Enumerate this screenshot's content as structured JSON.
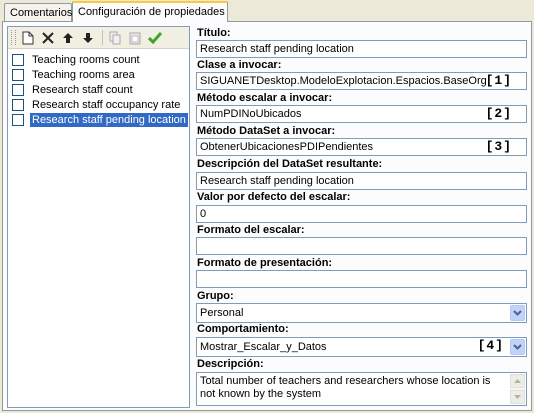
{
  "tabs": [
    {
      "label": "Comentarios"
    },
    {
      "label": "Configuración de propiedades"
    }
  ],
  "toolbar": {
    "icons": [
      "new-icon",
      "delete-icon",
      "move-up-icon",
      "move-down-icon",
      "copy-icon",
      "paste-icon",
      "apply-check-icon"
    ]
  },
  "list": {
    "items": [
      {
        "label": "Teaching rooms count",
        "checked": false,
        "selected": false
      },
      {
        "label": "Teaching rooms area",
        "checked": false,
        "selected": false
      },
      {
        "label": "Research staff count",
        "checked": false,
        "selected": false
      },
      {
        "label": "Research staff occupancy rate",
        "checked": false,
        "selected": false
      },
      {
        "label": "Research staff pending location",
        "checked": false,
        "selected": true
      }
    ]
  },
  "form": {
    "titulo": {
      "label": "Título:",
      "value": "Research staff pending location"
    },
    "clase": {
      "label": "Clase a invocar:",
      "value": "SIGUANETDesktop.ModeloExplotacion.Espacios.BaseOrg",
      "marker": "[1]"
    },
    "metodo_escalar": {
      "label": "Método escalar a invocar:",
      "value": "NumPDINoUbicados",
      "marker": "[2]"
    },
    "metodo_dataset": {
      "label": "Método DataSet a invocar:",
      "value": "ObtenerUbicacionesPDIPendientes",
      "marker": "[3]"
    },
    "descripcion_dataset": {
      "label": "Descripción del DataSet resultante:",
      "value": "Research staff pending location"
    },
    "valor_defecto": {
      "label": "Valor por defecto del escalar:",
      "value": "0"
    },
    "formato_escalar": {
      "label": "Formato del escalar:",
      "value": ""
    },
    "formato_presentacion": {
      "label": "Formato de presentación:",
      "value": ""
    },
    "grupo": {
      "label": "Grupo:",
      "value": "Personal"
    },
    "comportamiento": {
      "label": "Comportamiento:",
      "value": "Mostrar_Escalar_y_Datos",
      "marker": "[4]"
    },
    "descripcion": {
      "label": "Descripción:",
      "value": "Total number of teachers and researchers whose location is not known by the system"
    }
  },
  "colors": {
    "selection": "#316ac5",
    "tab_highlight": "#ffc83c",
    "field_border": "#7f9db9",
    "window_bg": "#ece9d8"
  }
}
